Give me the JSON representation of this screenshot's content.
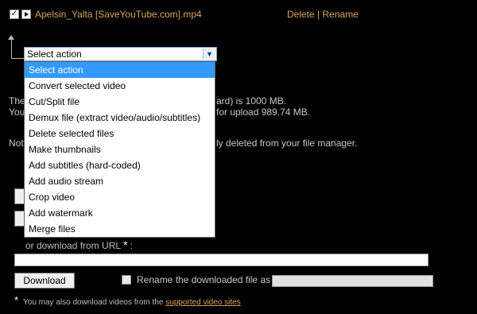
{
  "file": {
    "name": "Apelsin_Yalta [SaveYouTube.com].mp4",
    "check_mark": "✓",
    "actions": {
      "delete": "Delete",
      "separator": "|",
      "rename": "Rename"
    }
  },
  "select": {
    "value": "Select action",
    "arrow": "▼",
    "options": [
      "Select action",
      "Convert selected video",
      "Cut/Split file",
      "Demux file (extract video/audio/subtitles)",
      "Delete selected files",
      "Make thumbnails",
      "Add subtitles (hard-coded)",
      "Add audio stream",
      "Crop video",
      "Add watermark",
      "Merge files"
    ]
  },
  "background_text": {
    "line1_start": "The",
    "line1_end": "ard) is 1000 MB.",
    "line2_start": "You",
    "line2_end": "for upload 989.74 MB.",
    "line3_start": "Not",
    "line3_end": "ly deleted from your file manager."
  },
  "download": {
    "url_label": "or download from URL",
    "asterisk": "*",
    "colon": ":",
    "button": "Download",
    "rename_label": "Rename the downloaded file as",
    "footnote_star": "*",
    "footnote_text": "You may also download videos from the",
    "footnote_link": "supported video sites"
  },
  "colors": {
    "background": "#000000",
    "accent": "#d9a35c",
    "selection": "#3399ff"
  }
}
